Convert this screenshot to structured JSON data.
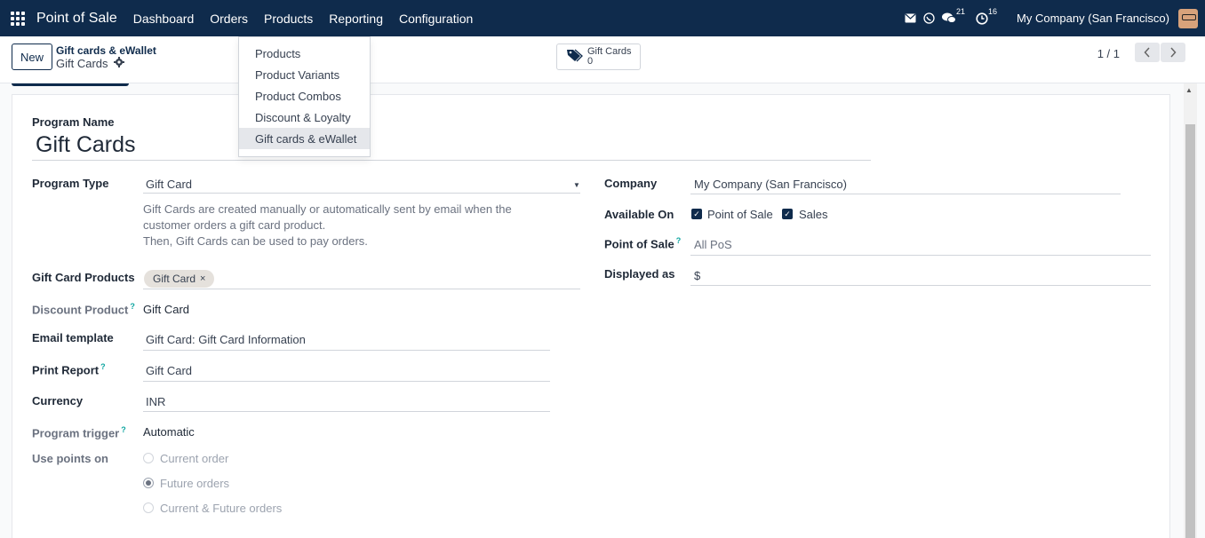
{
  "navbar": {
    "app_name": "Point of Sale",
    "menus": [
      "Dashboard",
      "Orders",
      "Products",
      "Reporting",
      "Configuration"
    ],
    "messages_count": "21",
    "activities_count": "16",
    "company": "My Company (San Francisco)"
  },
  "products_menu": {
    "items": [
      "Products",
      "Product Variants",
      "Product Combos",
      "Discount & Loyalty",
      "Gift cards & eWallet"
    ],
    "active_item": "Gift cards & eWallet"
  },
  "control_panel": {
    "new_label": "New",
    "breadcrumb_parent": "Gift cards & eWallet",
    "breadcrumb_current": "Gift Cards",
    "smart_button_label": "Gift Cards",
    "smart_button_count": "0",
    "pager": "1 / 1"
  },
  "form": {
    "program_name_label": "Program Name",
    "program_name": "Gift Cards",
    "program_type_label": "Program Type",
    "program_type": "Gift Card",
    "program_type_desc_1": "Gift Cards are created manually or automatically sent by email when the customer orders a gift card product.",
    "program_type_desc_2": "Then, Gift Cards can be used to pay orders.",
    "gift_card_products_label": "Gift Card Products",
    "gift_card_product_tag": "Gift Card",
    "discount_product_label": "Discount Product",
    "discount_product": "Gift Card",
    "email_template_label": "Email template",
    "email_template": "Gift Card: Gift Card Information",
    "print_report_label": "Print Report",
    "print_report": "Gift Card",
    "currency_label": "Currency",
    "currency": "INR",
    "program_trigger_label": "Program trigger",
    "program_trigger": "Automatic",
    "use_points_label": "Use points on",
    "use_points_options": [
      "Current order",
      "Future orders",
      "Current & Future orders"
    ],
    "use_points_selected": "Future orders",
    "company_label": "Company",
    "company": "My Company (San Francisco)",
    "available_on_label": "Available On",
    "available_on_pos": "Point of Sale",
    "available_on_sales": "Sales",
    "point_of_sale_label": "Point of Sale",
    "point_of_sale_placeholder": "All PoS",
    "displayed_as_label": "Displayed as",
    "displayed_as": "$"
  },
  "icons": [
    "apps-grid-icon",
    "envelope-icon",
    "whatsapp-icon",
    "chat-icon",
    "clock-icon",
    "gear-icon",
    "tag-icon",
    "chevron-left-icon",
    "chevron-right-icon",
    "dropdown-caret-icon",
    "checkbox-checked-icon",
    "radio-icon"
  ],
  "colors": {
    "navbar_bg": "#0f2b4c",
    "accent": "#0f2b4c"
  }
}
